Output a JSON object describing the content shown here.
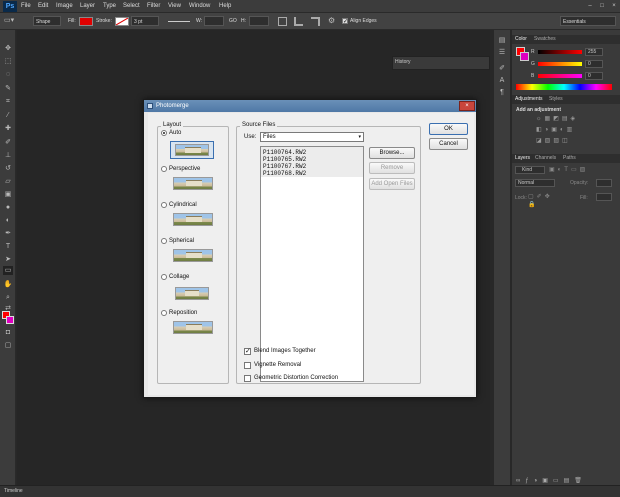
{
  "app": {
    "logo": "Ps"
  },
  "menu": [
    "File",
    "Edit",
    "Image",
    "Layer",
    "Type",
    "Select",
    "Filter",
    "View",
    "Window",
    "Help"
  ],
  "window_controls": [
    "–",
    "□",
    "×"
  ],
  "options_bar": {
    "shape_mode": "Shape",
    "fill_label": "Fill:",
    "stroke_label": "Stroke:",
    "stroke_width": "3 pt",
    "w_label": "W:",
    "go_label": "GO",
    "h_label": "H:",
    "align_edges": "Align Edges",
    "workspace": "Essentials"
  },
  "colors": {
    "accent": "#4fa7ff",
    "foreground": "#ff0000",
    "background": "#e000c0",
    "dialog_title": "#5a82ae"
  },
  "right_panels": {
    "color_tabs": [
      "Color",
      "Swatches"
    ],
    "color_values": {
      "r": "255",
      "g": "0",
      "b": "0"
    },
    "color_labels": {
      "r": "R",
      "g": "G",
      "b": "B"
    },
    "adjust_tabs": [
      "Adjustments",
      "Styles"
    ],
    "adjust_title": "Add an adjustment",
    "layers_tabs": [
      "Layers",
      "Channels",
      "Paths"
    ],
    "layers_kind": "Kind",
    "layers_blend": "Normal",
    "layers_opacity_label": "Opacity:",
    "layers_lock_label": "Lock:",
    "layers_fill_label": "Fill:"
  },
  "history": {
    "title": "History"
  },
  "timeline": {
    "title": "Timeline"
  },
  "dialog": {
    "title": "Photomerge",
    "close": "×",
    "layout_group": "Layout",
    "layouts": [
      {
        "label": "Auto",
        "selected": true
      },
      {
        "label": "Perspective",
        "selected": false
      },
      {
        "label": "Cylindrical",
        "selected": false
      },
      {
        "label": "Spherical",
        "selected": false
      },
      {
        "label": "Collage",
        "selected": false
      },
      {
        "label": "Reposition",
        "selected": false
      }
    ],
    "source_group": "Source Files",
    "use_label": "Use:",
    "use_value": "Files",
    "files": [
      "P1100764.RW2",
      "P1100765.RW2",
      "P1100767.RW2",
      "P1100768.RW2"
    ],
    "browse": "Browse...",
    "remove": "Remove",
    "add_open": "Add Open Files",
    "ok": "OK",
    "cancel": "Cancel",
    "options": [
      {
        "label": "Blend Images Together",
        "checked": true
      },
      {
        "label": "Vignette Removal",
        "checked": false
      },
      {
        "label": "Geometric Distortion Correction",
        "checked": false
      }
    ]
  }
}
